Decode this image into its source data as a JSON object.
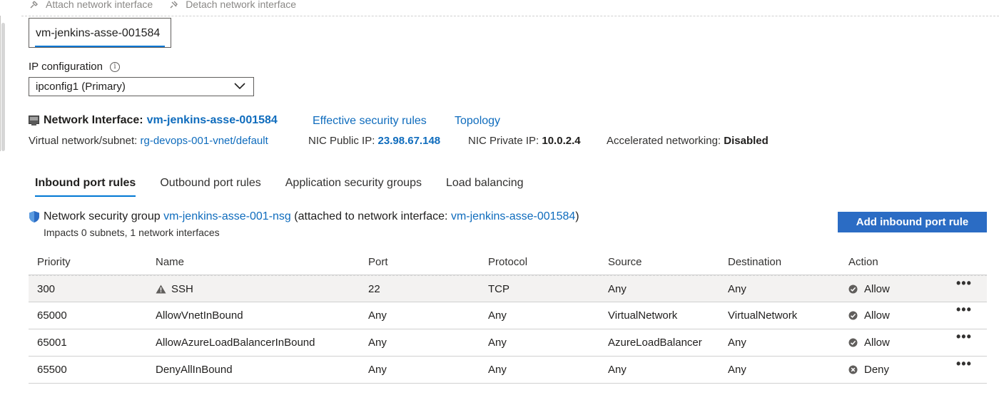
{
  "toolbar": {
    "attach_label": "Attach network interface",
    "detach_label": "Detach network interface"
  },
  "nic_selector": {
    "value": "vm-jenkins-asse-001584"
  },
  "ip_config": {
    "label": "IP configuration",
    "value": "ipconfig1 (Primary)"
  },
  "nic": {
    "label": "Network Interface:",
    "name": "vm-jenkins-asse-001584",
    "effective_rules_link": "Effective security rules",
    "topology_link": "Topology",
    "vnet_label": "Virtual network/subnet:",
    "vnet_value": "rg-devops-001-vnet/default",
    "public_ip_label": "NIC Public IP:",
    "public_ip_value": "23.98.67.148",
    "private_ip_label": "NIC Private IP:",
    "private_ip_value": "10.0.2.4",
    "accel_label": "Accelerated networking:",
    "accel_value": "Disabled"
  },
  "tabs": [
    {
      "label": "Inbound port rules",
      "active": true
    },
    {
      "label": "Outbound port rules",
      "active": false
    },
    {
      "label": "Application security groups",
      "active": false
    },
    {
      "label": "Load balancing",
      "active": false
    }
  ],
  "nsg": {
    "prefix": "Network security group",
    "name": "vm-jenkins-asse-001-nsg",
    "attached_text": "(attached to network interface:",
    "attached_nic": "vm-jenkins-asse-001584",
    "close_paren": ")",
    "impacts": "Impacts 0 subnets, 1 network interfaces"
  },
  "add_button_label": "Add inbound port rule",
  "table": {
    "headers": [
      "Priority",
      "Name",
      "Port",
      "Protocol",
      "Source",
      "Destination",
      "Action"
    ],
    "rows": [
      {
        "priority": "300",
        "name": "SSH",
        "warning": true,
        "port": "22",
        "protocol": "TCP",
        "source": "Any",
        "destination": "Any",
        "action": "Allow",
        "more": "•••"
      },
      {
        "priority": "65000",
        "name": "AllowVnetInBound",
        "warning": false,
        "port": "Any",
        "protocol": "Any",
        "source": "VirtualNetwork",
        "destination": "VirtualNetwork",
        "action": "Allow",
        "more": "•••"
      },
      {
        "priority": "65001",
        "name": "AllowAzureLoadBalancerInBound",
        "warning": false,
        "port": "Any",
        "protocol": "Any",
        "source": "AzureLoadBalancer",
        "destination": "Any",
        "action": "Allow",
        "more": "•••"
      },
      {
        "priority": "65500",
        "name": "DenyAllInBound",
        "warning": false,
        "port": "Any",
        "protocol": "Any",
        "source": "Any",
        "destination": "Any",
        "action": "Deny",
        "more": "•••"
      }
    ]
  },
  "colors": {
    "accent": "#0078d4",
    "link": "#0f6cbd",
    "primary_button": "#2b6cc4",
    "row_highlight": "#f3f2f1"
  }
}
